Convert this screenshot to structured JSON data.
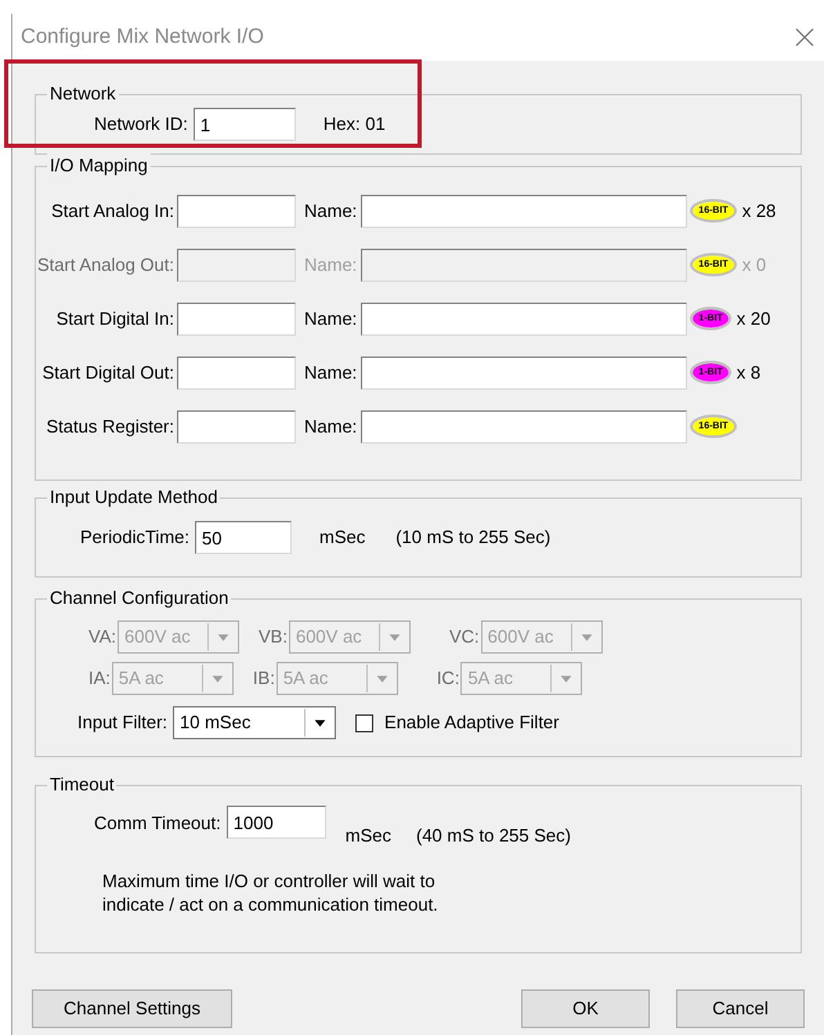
{
  "window": {
    "title": "Configure Mix Network I/O"
  },
  "network": {
    "title": "Network",
    "label": "Network ID:",
    "value": "1",
    "hex": "Hex: 01"
  },
  "io_mapping": {
    "title": "I/O Mapping",
    "rows": [
      {
        "label": "Start Analog In:",
        "name_label": "Name:",
        "badge": "16-BIT",
        "color": "#ffff00",
        "count": "x 28",
        "disabled": false
      },
      {
        "label": "Start Analog Out:",
        "name_label": "Name:",
        "badge": "16-BIT",
        "color": "#ffff00",
        "count": "x 0",
        "disabled": true
      },
      {
        "label": "Start Digital In:",
        "name_label": "Name:",
        "badge": "1-BIT",
        "color": "#ff00ff",
        "count": "x 20",
        "disabled": false
      },
      {
        "label": "Start Digital Out:",
        "name_label": "Name:",
        "badge": "1-BIT",
        "color": "#ff00ff",
        "count": "x 8",
        "disabled": false
      },
      {
        "label": "Status Register:",
        "name_label": "Name:",
        "badge": "16-BIT",
        "color": "#ffff00",
        "disabled": false
      }
    ]
  },
  "input_update": {
    "title": "Input Update Method",
    "label": "PeriodicTime:",
    "value": "50",
    "unit": "mSec",
    "range": "(10 mS to 255 Sec)"
  },
  "channel_config": {
    "title": "Channel Configuration",
    "selects": [
      {
        "label": "VA:",
        "value": "600V ac",
        "disabled": true
      },
      {
        "label": "VB:",
        "value": "600V ac",
        "disabled": true
      },
      {
        "label": "VC:",
        "value": "600V ac",
        "disabled": true
      },
      {
        "label": "IA:",
        "value": "5A ac",
        "disabled": true
      },
      {
        "label": "IB:",
        "value": "5A ac",
        "disabled": true
      },
      {
        "label": "IC:",
        "value": "5A ac",
        "disabled": true
      }
    ],
    "filter": {
      "label": "Input Filter:",
      "value": "10 mSec",
      "disabled": false
    },
    "adaptive": {
      "label": "Enable Adaptive Filter",
      "checked": false
    }
  },
  "timeout": {
    "title": "Timeout",
    "label": "Comm Timeout:",
    "value": "1000",
    "unit": "mSec",
    "range": "(40 mS to 255 Sec)",
    "note": "Maximum time I/O or controller will wait to indicate / act on a communication timeout."
  },
  "buttons": [
    {
      "label": "Channel Settings"
    },
    {
      "label": "OK"
    },
    {
      "label": "Cancel"
    }
  ]
}
